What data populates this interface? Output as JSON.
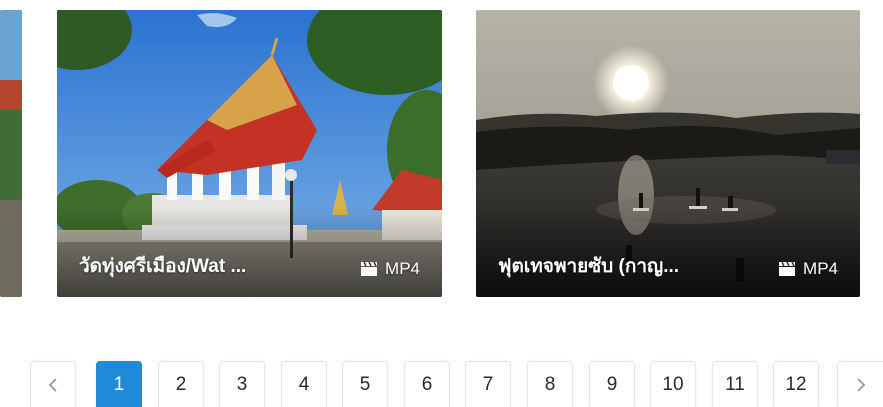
{
  "cards": [
    {
      "title": "",
      "format": ""
    },
    {
      "title": "วัดทุ่งศรีเมือง/Wat ...",
      "format": "MP4"
    },
    {
      "title": "ฟุตเทจพายซับ (กาญ...",
      "format": "MP4"
    }
  ],
  "pagination": {
    "prev_icon": "chevron-left-icon",
    "next_icon": "chevron-right-icon",
    "current": "1",
    "pages": [
      "1",
      "2",
      "3",
      "4",
      "5",
      "6",
      "7",
      "8",
      "9",
      "10",
      "11",
      "12"
    ],
    "accent_color": "#1f8ad8"
  },
  "format_icon": "film-clapper-icon"
}
